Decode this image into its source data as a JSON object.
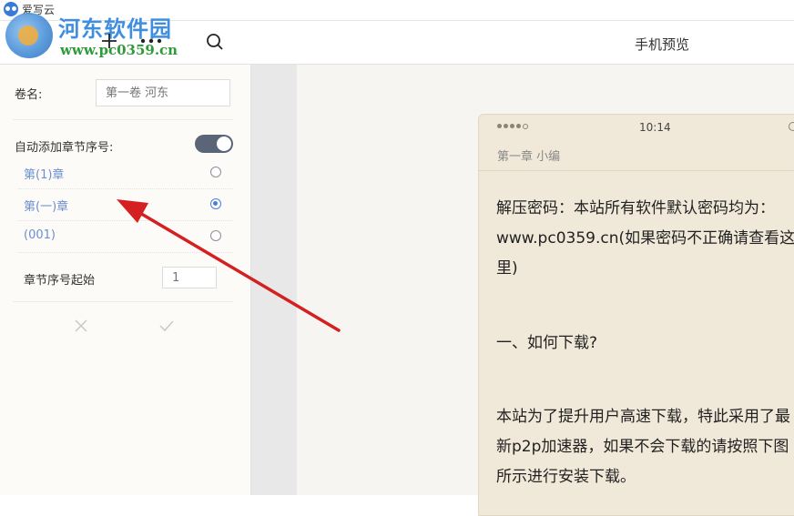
{
  "window": {
    "title": "爱写云"
  },
  "watermark": {
    "name": "河东软件园",
    "url": "www.pc0359.cn"
  },
  "toolbar": {
    "icons": [
      "add-icon",
      "more-icon",
      "search-icon"
    ]
  },
  "preview": {
    "title": "手机预览"
  },
  "settings": {
    "volume_label": "卷名:",
    "volume_placeholder": "第一卷 河东",
    "auto_number_label": "自动添加章节序号:",
    "auto_number_enabled": true,
    "options": [
      {
        "label": "第(1)章",
        "selected": false
      },
      {
        "label": "第(一)章",
        "selected": true
      },
      {
        "label": "(001)",
        "selected": false
      }
    ],
    "start_label": "章节序号起始",
    "start_value": "1"
  },
  "phone": {
    "time": "10:14",
    "chapter_title": "第一章 小编",
    "lines": [
      "解压密码：本站所有软件默认密码均为：",
      "www.pc0359.cn(如果密码不正确请查看这",
      "里)",
      "",
      "一、如何下载?",
      "",
      "本站为了提升用户高速下载，特此采用了最",
      "新p2p加速器，如果不会下载的请按照下图",
      "所示进行安装下载。"
    ]
  },
  "colors": {
    "accent_blue": "#4a7fd6",
    "toggle_on": "#5b6578",
    "phone_bg": "#f0e8d8",
    "arrow_red": "#d42020"
  }
}
